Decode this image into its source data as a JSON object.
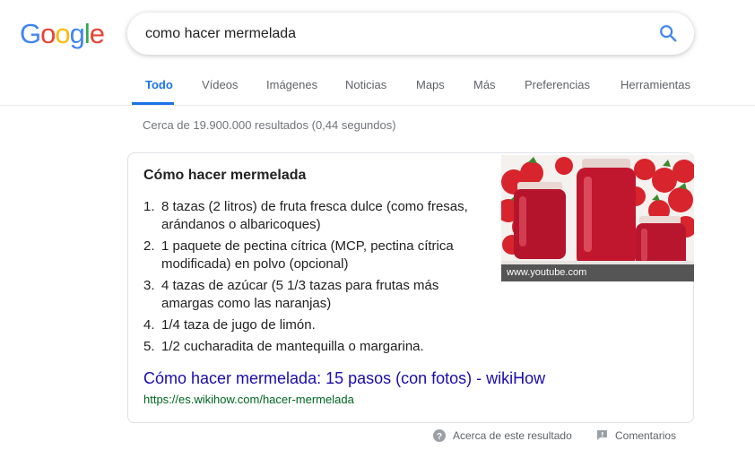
{
  "logo": {
    "letters": [
      "G",
      "o",
      "o",
      "g",
      "l",
      "e"
    ],
    "colors": [
      "#4285f4",
      "#ea4335",
      "#fbbc05",
      "#4285f4",
      "#34a853",
      "#ea4335"
    ]
  },
  "search": {
    "query": "como hacer mermelada",
    "icon": "search-icon"
  },
  "tabs": [
    {
      "label": "Todo",
      "active": true
    },
    {
      "label": "Vídeos"
    },
    {
      "label": "Imágenes"
    },
    {
      "label": "Noticias"
    },
    {
      "label": "Maps"
    },
    {
      "label": "Más"
    },
    {
      "label": "Preferencias"
    },
    {
      "label": "Herramientas"
    }
  ],
  "stats": "Cerca de 19.900.000 resultados (0,44 segundos)",
  "snippet": {
    "title": "Cómo hacer mermelada",
    "steps": [
      {
        "num": "1.",
        "text": "8 tazas (2 litros) de fruta fresca dulce (como fresas, arándanos o albaricoques)"
      },
      {
        "num": "2.",
        "text": "1 paquete de pectina cítrica (MCP, pectina cítrica modificada) en polvo (opcional)"
      },
      {
        "num": "3.",
        "text": "4 tazas de azúcar (5 1/3 tazas para frutas más amargas como las naranjas)"
      },
      {
        "num": "4.",
        "text": "1/4 taza de jugo de limón."
      },
      {
        "num": "5.",
        "text": "1/2 cucharadita de mantequilla o margarina."
      }
    ],
    "image_caption": "www.youtube.com",
    "link_title": "Cómo hacer mermelada: 15 pasos (con fotos) - wikiHow",
    "link_url": "https://es.wikihow.com/hacer-mermelada"
  },
  "footer": {
    "about": "Acerca de este resultado",
    "feedback": "Comentarios"
  },
  "colors": {
    "link": "#1a0dab",
    "url": "#006621",
    "accent": "#1a73e8",
    "muted": "#70757a"
  }
}
